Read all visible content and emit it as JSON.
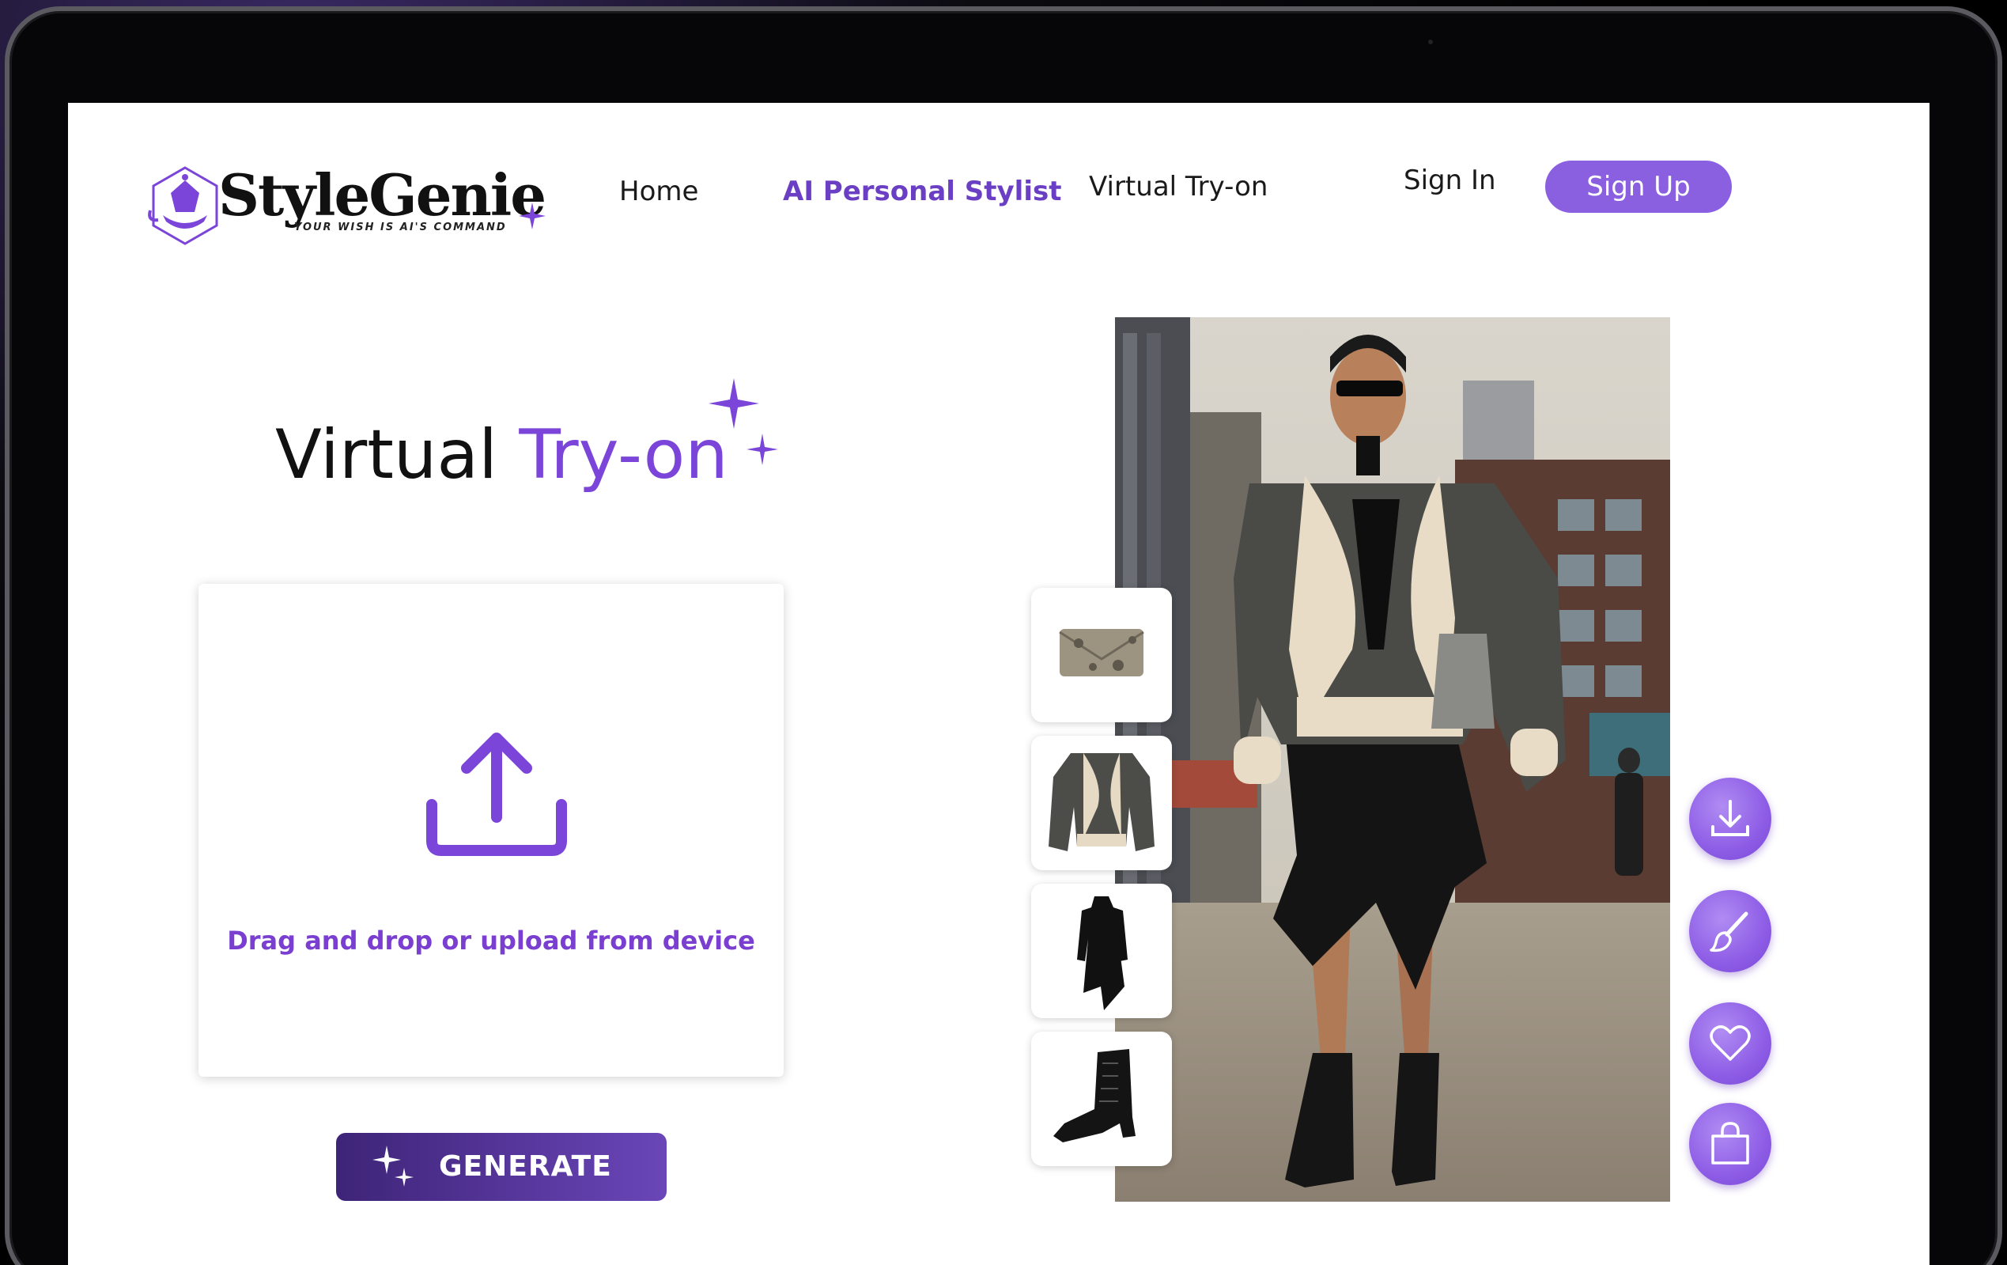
{
  "brand": {
    "name": "StyleGenie",
    "tagline": "YOUR WISH IS AI'S COMMAND"
  },
  "nav": {
    "home": "Home",
    "ai_stylist": "AI Personal Stylist",
    "virtual_tryon": "Virtual Try-on",
    "sign_in": "Sign In",
    "sign_up": "Sign Up"
  },
  "page": {
    "title_main": "Virtual ",
    "title_accent": "Try-on"
  },
  "upload": {
    "prompt": "Drag and drop or upload from device"
  },
  "generate": {
    "label": "GENERATE"
  },
  "items": [
    {
      "name": "snakeskin clutch"
    },
    {
      "name": "shearling biker jacket"
    },
    {
      "name": "black ruffle dress"
    },
    {
      "name": "black lace-up boot"
    }
  ],
  "actions": [
    {
      "name": "download",
      "icon": "download-icon"
    },
    {
      "name": "edit",
      "icon": "brush-icon"
    },
    {
      "name": "favorite",
      "icon": "heart-icon"
    },
    {
      "name": "shop",
      "icon": "shopping-bag-icon"
    }
  ],
  "colors": {
    "accent": "#7a45d8",
    "button": "#8a5fe0",
    "generate_start": "#3e2478",
    "generate_end": "#6a46b8"
  }
}
